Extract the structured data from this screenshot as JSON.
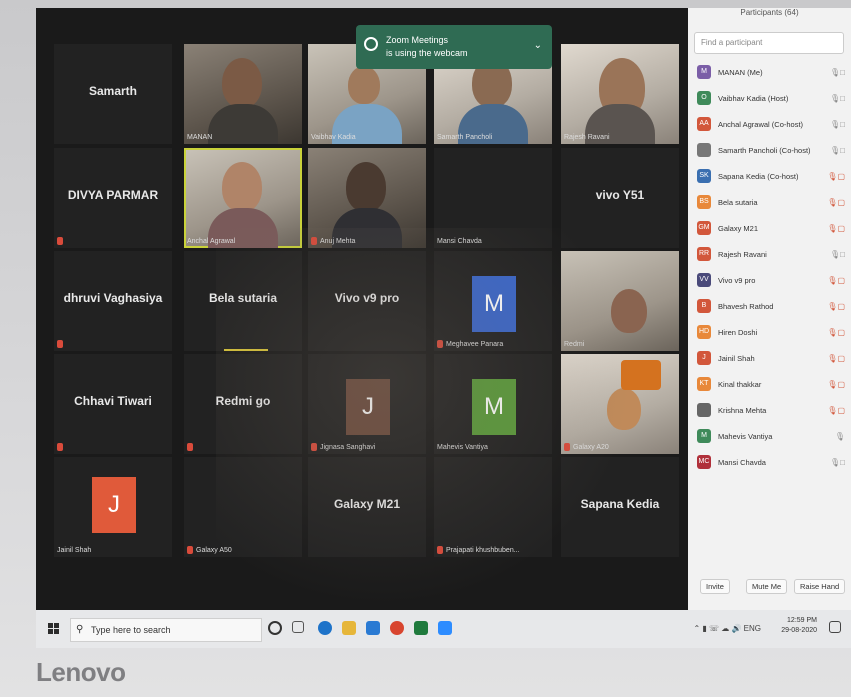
{
  "notification": {
    "title": "Zoom Meetings",
    "message": "is using the webcam"
  },
  "tiles": [
    {
      "key": "samarth",
      "label": "Samarth",
      "caption": ""
    },
    {
      "key": "manan",
      "label": "",
      "caption": "MANAN"
    },
    {
      "key": "vaibhav",
      "label": "",
      "caption": "Vaibhav Kadia"
    },
    {
      "key": "samarthp",
      "label": "",
      "caption": "Samarth Pancholi"
    },
    {
      "key": "rajesh",
      "label": "",
      "caption": "Rajesh Ravani"
    },
    {
      "key": "divya",
      "label": "DIVYA PARMAR",
      "caption": ""
    },
    {
      "key": "anchal",
      "label": "",
      "caption": "Anchal Agrawal"
    },
    {
      "key": "anuj",
      "label": "",
      "caption": "Anuj Mehta"
    },
    {
      "key": "mansi",
      "label": "",
      "caption": "Mansi Chavda"
    },
    {
      "key": "vivoy51",
      "label": "vivo Y51",
      "caption": ""
    },
    {
      "key": "dhruvi",
      "label": "dhruvi Vaghasiya",
      "caption": ""
    },
    {
      "key": "bela",
      "label": "Bela sutaria",
      "caption": ""
    },
    {
      "key": "vivov9",
      "label": "Vivo v9 pro",
      "caption": ""
    },
    {
      "key": "meghavee",
      "label": "",
      "caption": "Meghavee Panara",
      "avatar": "M"
    },
    {
      "key": "redmi",
      "label": "",
      "caption": "Redmi"
    },
    {
      "key": "chhavi",
      "label": "Chhavi Tiwari",
      "caption": ""
    },
    {
      "key": "redmigo",
      "label": "Redmi go",
      "caption": ""
    },
    {
      "key": "jignasa",
      "label": "",
      "caption": "Jignasa Sanghavi",
      "avatar": "J"
    },
    {
      "key": "mahevis",
      "label": "",
      "caption": "Mahevis Vantiya",
      "avatar": "M"
    },
    {
      "key": "galaxya20",
      "label": "",
      "caption": "Galaxy A20"
    },
    {
      "key": "jainil",
      "label": "",
      "caption": "Jainil Shah",
      "avatar": "J"
    },
    {
      "key": "galaxya50",
      "label": "",
      "caption": "Galaxy A50"
    },
    {
      "key": "galaxym21",
      "label": "Galaxy M21",
      "caption": ""
    },
    {
      "key": "prajapati",
      "label": "",
      "caption": "Prajapati khushbuben..."
    },
    {
      "key": "sapana",
      "label": "Sapana Kedia",
      "caption": ""
    }
  ],
  "participants_panel": {
    "title": "Participants (64)",
    "search_placeholder": "Find a participant",
    "items": [
      {
        "initials": "M",
        "name": "MANAN (Me)",
        "color": "#7b5ea7"
      },
      {
        "initials": "O",
        "name": "Vaibhav Kadia (Host)",
        "color": "#3f8a5a"
      },
      {
        "initials": "AA",
        "name": "Anchal Agrawal (Co-host)",
        "color": "#d2573b"
      },
      {
        "initials": "",
        "name": "Samarth Pancholi (Co-host)",
        "color": "#777777"
      },
      {
        "initials": "SK",
        "name": "Sapana Kedia (Co-host)",
        "color": "#3a6fb0"
      },
      {
        "initials": "BS",
        "name": "Bela sutaria",
        "color": "#e8883a"
      },
      {
        "initials": "GM",
        "name": "Galaxy M21",
        "color": "#d2573b"
      },
      {
        "initials": "RR",
        "name": "Rajesh Ravani",
        "color": "#d2573b"
      },
      {
        "initials": "VV",
        "name": "Vivo v9 pro",
        "color": "#4a4a7a"
      },
      {
        "initials": "B",
        "name": "Bhavesh Rathod",
        "color": "#d2573b"
      },
      {
        "initials": "HD",
        "name": "Hiren Doshi",
        "color": "#e8883a"
      },
      {
        "initials": "J",
        "name": "Jainil Shah",
        "color": "#d2573b"
      },
      {
        "initials": "KT",
        "name": "Kinal thakkar",
        "color": "#e8883a"
      },
      {
        "initials": "",
        "name": "Krishna Mehta",
        "color": "#666666"
      },
      {
        "initials": "M",
        "name": "Mahevis Vantiya",
        "color": "#3f8a5a"
      },
      {
        "initials": "MC",
        "name": "Mansi Chavda",
        "color": "#b0303a"
      }
    ],
    "buttons": {
      "invite": "Invite",
      "mute_me": "Mute Me",
      "raise_hand": "Raise Hand"
    }
  },
  "taskbar": {
    "search_placeholder": "Type here to search",
    "time": "12:59 PM",
    "date": "29-08-2020",
    "lang": "ENG"
  },
  "brand": "Lenovo"
}
